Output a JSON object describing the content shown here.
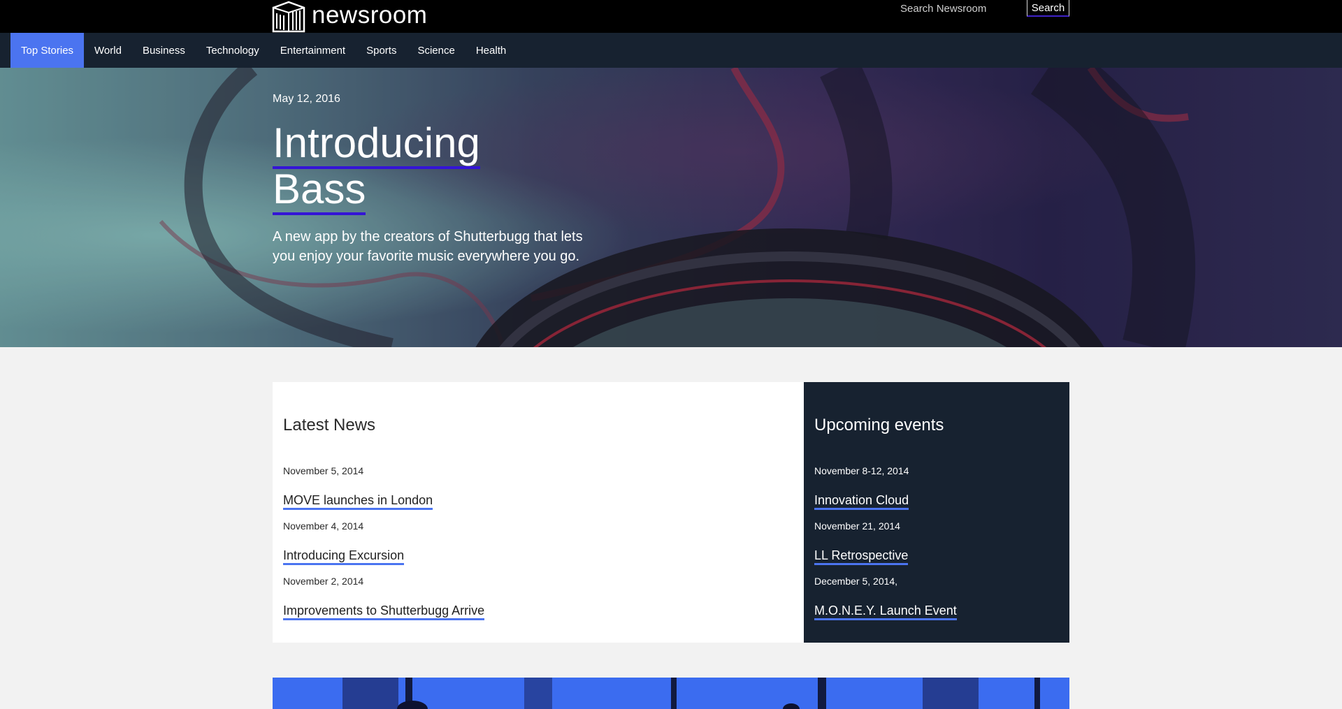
{
  "header": {
    "logo_text": "newsroom",
    "search_placeholder": "Search Newsroom",
    "search_button": "Search"
  },
  "nav": {
    "items": [
      "Top Stories",
      "World",
      "Business",
      "Technology",
      "Entertainment",
      "Sports",
      "Science",
      "Health"
    ],
    "active": "Top Stories"
  },
  "hero": {
    "date": "May 12, 2016",
    "title_line1": "Introducing",
    "title_line2": "Bass",
    "subtitle": "A new app by the creators of Shutterbugg that lets you enjoy your favorite music everywhere you go."
  },
  "latest_news": {
    "title": "Latest News",
    "items": [
      {
        "date": "November 5, 2014",
        "headline": "MOVE launches in London"
      },
      {
        "date": "November 4, 2014",
        "headline": "Introducing Excursion"
      },
      {
        "date": "November 2, 2014",
        "headline": "Improvements to Shutterbugg Arrive"
      }
    ]
  },
  "upcoming_events": {
    "title": "Upcoming events",
    "items": [
      {
        "date": "November 8-12, 2014",
        "name": "Innovation Cloud"
      },
      {
        "date": "November 21, 2014",
        "name": "LL Retrospective"
      },
      {
        "date": "December 5, 2014,",
        "name": "M.O.N.E.Y. Launch Event"
      }
    ]
  },
  "colors": {
    "top_bar": "#000000",
    "nav_bg": "#172230",
    "nav_active": "#4b74f0",
    "link_underline": "#4b74f0",
    "hero_underline": "#3414d6",
    "page_bg": "#f2f2f2",
    "events_bg": "#172230",
    "feature_bg": "#3b6cf0"
  },
  "icons": {
    "logo": "building-logo-icon"
  }
}
